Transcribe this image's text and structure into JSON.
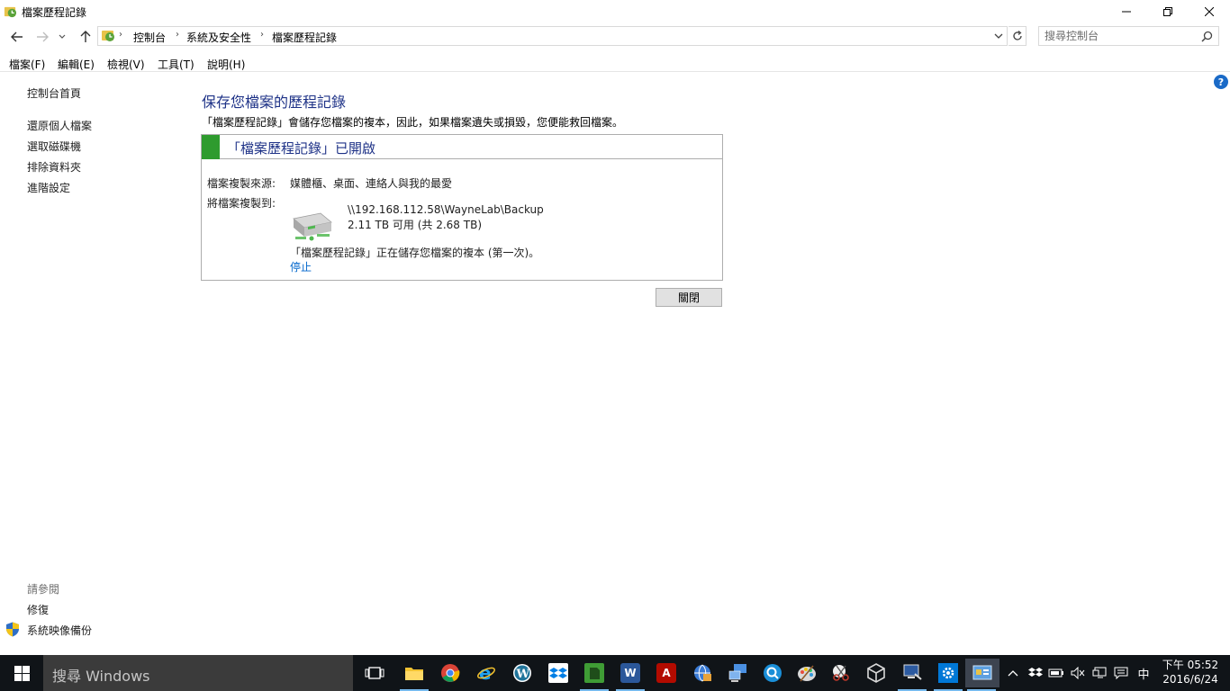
{
  "window": {
    "title": "檔案歷程記錄"
  },
  "address": {
    "crumbs": [
      "控制台",
      "系統及安全性",
      "檔案歷程記錄"
    ],
    "search_placeholder": "搜尋控制台"
  },
  "menu": [
    "檔案(F)",
    "編輯(E)",
    "檢視(V)",
    "工具(T)",
    "說明(H)"
  ],
  "left_pane": {
    "home": "控制台首頁",
    "links": [
      "還原個人檔案",
      "選取磁碟機",
      "排除資料夾",
      "進階設定"
    ],
    "see_also_title": "請參閱",
    "see_also": [
      "修復",
      "系統映像備份"
    ]
  },
  "help_label": "?",
  "main": {
    "title": "保存您檔案的歷程記錄",
    "description": "「檔案歷程記錄」會儲存您檔案的複本，因此，如果檔案遺失或損毀，您便能救回檔案。",
    "panel": {
      "status_title": "「檔案歷程記錄」已開啟",
      "status_color": "#2e9b2e",
      "copy_from_label": "檔案複製來源:",
      "copy_from_value": "媒體櫃、桌面、連絡人與我的最愛",
      "copy_to_label": "將檔案複製到:",
      "drive_path": "\\\\192.168.112.58\\WayneLab\\Backup",
      "drive_space": "2.11 TB 可用 (共 2.68 TB)",
      "progress_text": "「檔案歷程記錄」正在儲存您檔案的複本 (第一次)。",
      "stop_link": "停止"
    },
    "close_button": "關閉"
  },
  "taskbar": {
    "search_text": "搜尋 Windows",
    "time": "下午 05:52",
    "date": "2016/6/24",
    "ime": "中"
  }
}
